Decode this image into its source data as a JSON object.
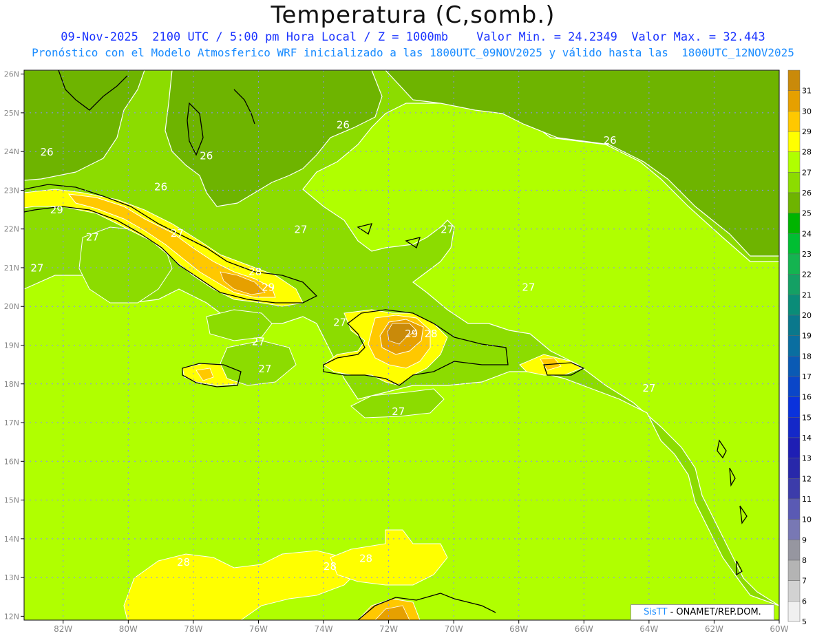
{
  "header": {
    "title": "Temperatura (C,somb.)",
    "subtitle_line1": "09-Nov-2025  2100 UTC / 5:00 pm Hora Local / Z = 1000mb    Valor Min. = 24.2349  Valor Max. = 32.443",
    "subtitle_line2": "Pronóstico con el Modelo Atmosferico WRF inicializado a las 1800UTC_09NOV2025 y válido hasta las  1800UTC_12NOV2025"
  },
  "map": {
    "lon_range": [
      -83.2,
      -60
    ],
    "lat_range": [
      11.9,
      26.1
    ],
    "lon_ticks": [
      "82W",
      "80W",
      "78W",
      "76W",
      "74W",
      "72W",
      "70W",
      "68W",
      "66W",
      "64W",
      "62W",
      "60W"
    ],
    "lat_ticks": [
      "26N",
      "25N",
      "24N",
      "23N",
      "22N",
      "21N",
      "20N",
      "19N",
      "18N",
      "17N",
      "16N",
      "15N",
      "14N",
      "13N",
      "12N"
    ],
    "contour_labels": [
      {
        "text": "26",
        "lon": -82.5,
        "lat": 23.9
      },
      {
        "text": "26",
        "lon": -77.6,
        "lat": 23.8
      },
      {
        "text": "26",
        "lon": -73.4,
        "lat": 24.6
      },
      {
        "text": "26",
        "lon": -79.0,
        "lat": 23.0
      },
      {
        "text": "26",
        "lon": -65.2,
        "lat": 24.2
      },
      {
        "text": "29",
        "lon": -82.2,
        "lat": 22.4
      },
      {
        "text": "27",
        "lon": -78.5,
        "lat": 21.8
      },
      {
        "text": "27",
        "lon": -81.1,
        "lat": 21.7
      },
      {
        "text": "27",
        "lon": -82.8,
        "lat": 20.9
      },
      {
        "text": "27",
        "lon": -74.7,
        "lat": 21.9
      },
      {
        "text": "27",
        "lon": -70.2,
        "lat": 21.9
      },
      {
        "text": "28",
        "lon": -76.1,
        "lat": 20.8
      },
      {
        "text": "29",
        "lon": -75.7,
        "lat": 20.4
      },
      {
        "text": "27",
        "lon": -73.5,
        "lat": 19.5
      },
      {
        "text": "27",
        "lon": -76.0,
        "lat": 19.0
      },
      {
        "text": "27",
        "lon": -75.8,
        "lat": 18.3
      },
      {
        "text": "29",
        "lon": -71.3,
        "lat": 19.2
      },
      {
        "text": "28",
        "lon": -70.7,
        "lat": 19.2
      },
      {
        "text": "27",
        "lon": -67.7,
        "lat": 20.4
      },
      {
        "text": "27",
        "lon": -71.7,
        "lat": 17.2
      },
      {
        "text": "27",
        "lon": -64.0,
        "lat": 17.8
      },
      {
        "text": "28",
        "lon": -78.3,
        "lat": 13.3
      },
      {
        "text": "28",
        "lon": -73.8,
        "lat": 13.2
      },
      {
        "text": "28",
        "lon": -72.7,
        "lat": 13.4
      }
    ]
  },
  "colorbar": {
    "labels": [
      "31",
      "30",
      "29",
      "28",
      "27",
      "26",
      "25",
      "24",
      "23",
      "22",
      "21",
      "20",
      "19",
      "18",
      "17",
      "16",
      "15",
      "14",
      "13",
      "12",
      "11",
      "10",
      "9",
      "8",
      "7",
      "6",
      "5"
    ],
    "colors": [
      "#c98a0a",
      "#e6a000",
      "#ffc800",
      "#ffff00",
      "#b0ff00",
      "#8cdc00",
      "#6eb400",
      "#00b400",
      "#00be32",
      "#14b450",
      "#14a064",
      "#0a8c78",
      "#0a788c",
      "#0a6ea0",
      "#0a5ab4",
      "#0a46c8",
      "#0a32dc",
      "#1428c8",
      "#1e1eb4",
      "#2828aa",
      "#3c3caa",
      "#5a5ab4",
      "#7878b4",
      "#9696a0",
      "#b4b4b4",
      "#d2d2d2",
      "#f0f0f0"
    ]
  },
  "credit": {
    "brand": "SisTT",
    "text": " - ONAMET/REP.DOM."
  },
  "colors": {
    "level_26": "#6eb400",
    "level_27": "#8cdc00",
    "level_28": "#b0ff00",
    "level_29": "#ffff00",
    "level_30": "#ffc800",
    "level_31": "#e6a000",
    "level_32": "#c98a0a",
    "contour": "#ffffff",
    "coastline": "#000000",
    "grid": "#9aa0ff"
  }
}
